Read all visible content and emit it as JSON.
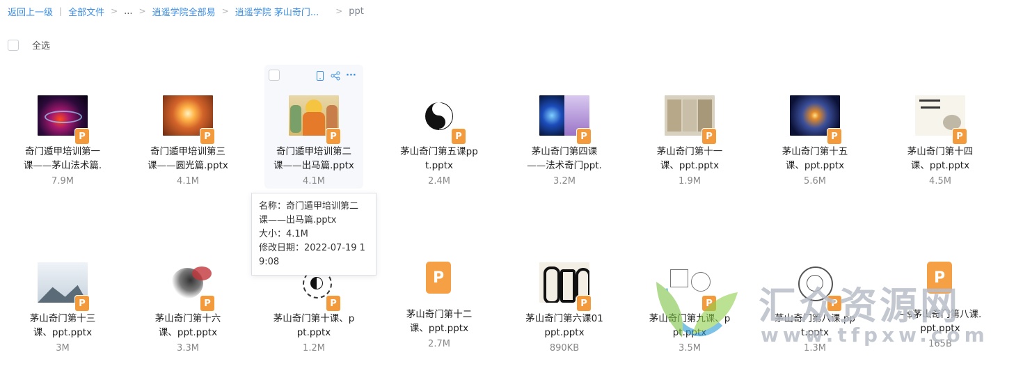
{
  "breadcrumb": {
    "back": "返回上一级",
    "sep_bar": "|",
    "sep": ">",
    "items": [
      "全部文件",
      "...",
      "逍遥学院全部易",
      "逍遥学院 茅山奇门...",
      "ppt"
    ]
  },
  "select_all": "全选",
  "hover_tools": {
    "icons": [
      "phone-icon",
      "share-icon",
      "more-icon"
    ],
    "more": "···"
  },
  "tooltip": {
    "line1": "名称：奇门遁甲培训第二",
    "line2": "课——出马篇.pptx",
    "line3": "大小：4.1M",
    "line4": "修改日期：2022-07-19 1",
    "line5": "9:08"
  },
  "file_icon_letter": "P",
  "files": [
    {
      "name1": "奇门遁甲培训第一",
      "name2": "课——茅山法术篇.",
      "size": "7.9M",
      "thumb": "fire"
    },
    {
      "name1": "奇门遁甲培训第三",
      "name2": "课——圆光篇.pptx",
      "size": "4.1M",
      "thumb": "orb"
    },
    {
      "name1": "奇门遁甲培训第二",
      "name2": "课——出马篇.pptx",
      "size": "4.1M",
      "thumb": "deity"
    },
    {
      "name1": "茅山奇门第五课pp",
      "name2": "t.pptx",
      "size": "2.4M",
      "thumb": "yinyang"
    },
    {
      "name1": "茅山奇门第四课",
      "name2": "——法术奇门ppt.",
      "size": "3.2M",
      "thumb": "blue"
    },
    {
      "name1": "茅山奇门第十一",
      "name2": "课、ppt.pptx",
      "size": "1.9M",
      "thumb": "scroll"
    },
    {
      "name1": "茅山奇门第十五",
      "name2": "课、ppt.pptx",
      "size": "5.6M",
      "thumb": "galaxy"
    },
    {
      "name1": "茅山奇门第十四",
      "name2": "课、ppt.pptx",
      "size": "4.5M",
      "thumb": "calligraphy"
    },
    {
      "name1": "茅山奇门第十三",
      "name2": "课、ppt.pptx",
      "size": "3M",
      "thumb": "mountain"
    },
    {
      "name1": "茅山奇门第十六",
      "name2": "课、ppt.pptx",
      "size": "3.3M",
      "thumb": "ink"
    },
    {
      "name1": "茅山奇门第十课、p",
      "name2": "pt.pptx",
      "size": "1.2M",
      "thumb": "bagua"
    },
    {
      "name1": "茅山奇门第十二",
      "name2": "课、ppt.pptx",
      "size": "2.7M",
      "thumb": "none"
    },
    {
      "name1": "茅山奇门第六课01",
      "name2": "ppt.pptx",
      "size": "890KB",
      "thumb": "talisman"
    },
    {
      "name1": "茅山奇门第九课、p",
      "name2": "pt.pptx",
      "size": "3.5M",
      "thumb": "diagram"
    },
    {
      "name1": "茅山奇门第八课.pp",
      "name2": "t.pptx",
      "size": "1.3M",
      "thumb": "wheel"
    },
    {
      "name1": "~$茅山奇门第八课.",
      "name2": "ppt.pptx",
      "size": "165B",
      "thumb": "none"
    }
  ],
  "watermark": {
    "title": "汇众资源网",
    "url": "www.tfpxw.com"
  }
}
